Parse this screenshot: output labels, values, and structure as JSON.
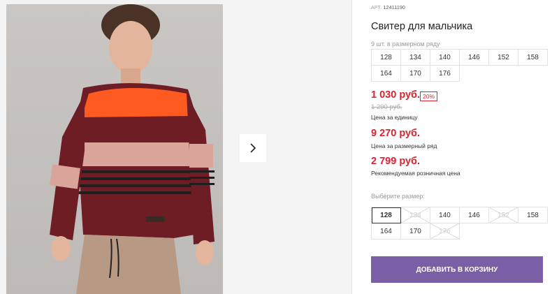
{
  "gallery": {
    "next_icon": "chevron-right-icon"
  },
  "product": {
    "article_label": "АРТ.",
    "article": "12411190",
    "title": "Свитер для мальчика",
    "pack_label": "9 шт. в размерном ряду",
    "pack_sizes": [
      "128",
      "134",
      "140",
      "146",
      "152",
      "158",
      "164",
      "170",
      "176"
    ],
    "price_unit": "1 030 руб.",
    "discount": "20%",
    "old_price": "1 290 руб.",
    "price_unit_caption": "Цена за единицу",
    "price_pack": "9 270 руб.",
    "price_pack_caption": "Цена за размерный ряд",
    "price_rrp": "2 799 руб.",
    "price_rrp_caption": "Рекомендуемая розничная цена",
    "choose_label": "Выберите размер:",
    "choose_sizes": [
      {
        "label": "128",
        "state": "selected"
      },
      {
        "label": "134",
        "state": "disabled"
      },
      {
        "label": "140",
        "state": "available"
      },
      {
        "label": "146",
        "state": "available"
      },
      {
        "label": "152",
        "state": "disabled"
      },
      {
        "label": "158",
        "state": "available"
      },
      {
        "label": "164",
        "state": "available"
      },
      {
        "label": "170",
        "state": "available"
      },
      {
        "label": "176",
        "state": "disabled"
      }
    ],
    "add_to_cart": "ДОБАВИТЬ В КОРЗИНУ"
  },
  "colors": {
    "price": "#d9232f",
    "button": "#7b5fa6"
  }
}
